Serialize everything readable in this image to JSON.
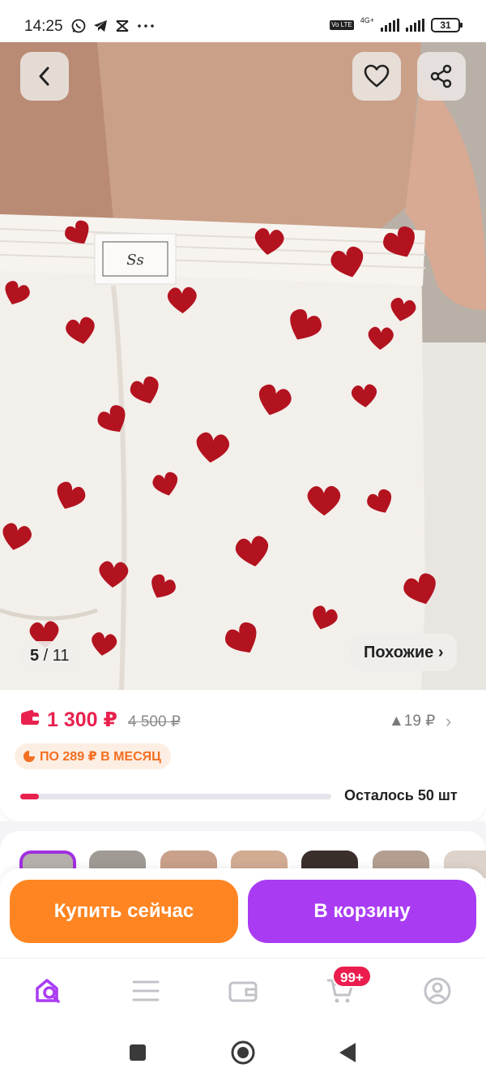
{
  "status_bar": {
    "time": "14:25",
    "app_icons": [
      "whatsapp-icon",
      "telegram-icon",
      "capcut-icon",
      "more-dots-icon"
    ],
    "volte": "Vo LTE",
    "network": "4G+",
    "battery": "31"
  },
  "hero": {
    "image_description_icon": "product-photo",
    "counter_current": "5",
    "counter_sep": " / ",
    "counter_total": "11",
    "similar_label": "Похожие ›"
  },
  "price": {
    "current": "1 300 ₽",
    "old": "4 500 ₽",
    "delta": "▲19 ₽",
    "installment": "ПО 289 ₽ В МЕСЯЦ",
    "stock_label": "Осталось 50 шт",
    "stock_progress": 0.06,
    "accent_color": "#e8214e"
  },
  "actions": {
    "buy_label": "Купить сейчас",
    "cart_label": "В корзину",
    "buy_color": "#ff8522",
    "cart_color": "#a93cf3"
  },
  "bottom_nav": {
    "items": [
      "search-home-icon",
      "catalog-icon",
      "wallet-icon",
      "cart-icon",
      "profile-icon"
    ],
    "cart_badge": "99+"
  },
  "system_nav": [
    "recents-icon",
    "home-icon",
    "back-icon"
  ]
}
